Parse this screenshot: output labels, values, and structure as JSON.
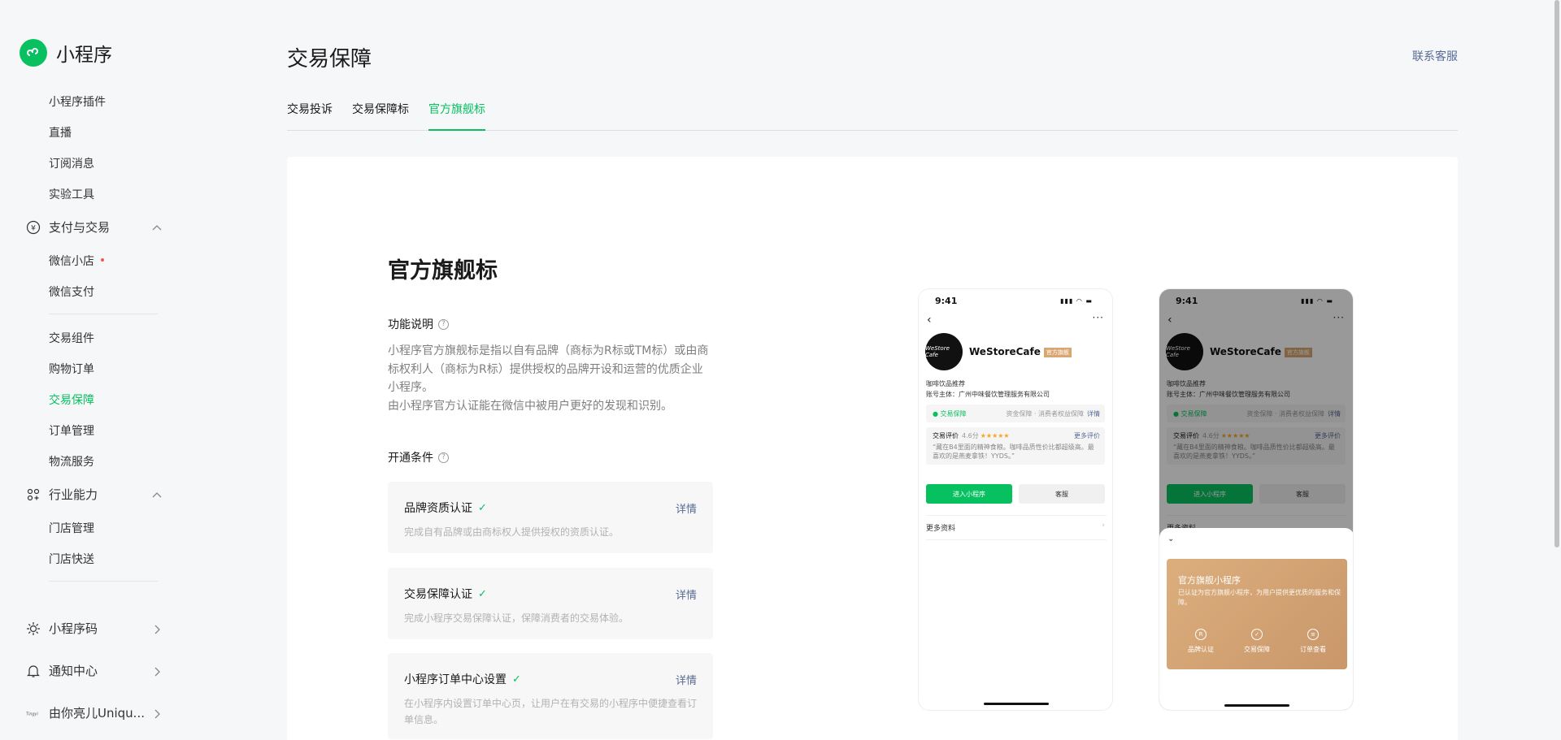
{
  "app": {
    "title": "小程序"
  },
  "sidebar": {
    "items_top": [
      {
        "label": "小程序插件"
      },
      {
        "label": "直播"
      },
      {
        "label": "订阅消息"
      },
      {
        "label": "实验工具"
      }
    ],
    "group_pay": {
      "label": "支付与交易",
      "icon": "yuan-icon"
    },
    "pay_items": [
      {
        "label": "微信小店",
        "badge_dot": true
      },
      {
        "label": "微信支付"
      }
    ],
    "trade_items": [
      {
        "label": "交易组件"
      },
      {
        "label": "购物订单"
      },
      {
        "label": "交易保障",
        "active": true
      },
      {
        "label": "订单管理"
      },
      {
        "label": "物流服务"
      }
    ],
    "group_industry": {
      "label": "行业能力",
      "icon": "industry-icon"
    },
    "industry_items": [
      {
        "label": "门店管理"
      },
      {
        "label": "门店快送"
      }
    ],
    "bottom": [
      {
        "label": "小程序码",
        "icon": "sun-icon"
      },
      {
        "label": "通知中心",
        "icon": "bell-icon"
      },
      {
        "label": "由你亮儿Uniqu...",
        "icon": "account-logo"
      }
    ]
  },
  "header": {
    "title": "交易保障",
    "contact": "联系客服"
  },
  "tabs": [
    {
      "label": "交易投诉"
    },
    {
      "label": "交易保障标"
    },
    {
      "label": "官方旗舰标",
      "active": true
    }
  ],
  "content": {
    "title": "官方旗舰标",
    "feature_heading": "功能说明",
    "feature_desc_1": "小程序官方旗舰标是指以自有品牌（商标为R标或TM标）或由商标权利人（商标为R标）提供授权的品牌开设和运营的优质企业小程序。",
    "feature_desc_2": "由小程序官方认证能在微信中被用户更好的发现和识别。",
    "conditions_heading": "开通条件",
    "conditions": [
      {
        "title": "品牌资质认证",
        "desc": "完成自有品牌或由商标权人提供授权的资质认证。",
        "link": "详情"
      },
      {
        "title": "交易保障认证",
        "desc": "完成小程序交易保障认证，保障消费者的交易体验。",
        "link": "详情"
      },
      {
        "title": "小程序订单中心设置",
        "desc": "在小程序内设置订单中心页，让用户在有交易的小程序中便捷查看订单信息。",
        "link": "详情"
      }
    ]
  },
  "phone": {
    "time": "9:41",
    "avatar_text": "WeStore Cafe",
    "brand": "WeStoreCafe",
    "tag": "官方旗舰",
    "line1": "咖啡饮品推荐",
    "line2": "账号主体：广州中味餐饮管理服务有限公司",
    "guarantee": "交易保障",
    "guarantee_desc": "资金保障 · 消费者权益保障",
    "guarantee_link": "详情",
    "review_label": "交易评价",
    "review_score": "4.6分",
    "review_stars": "★★★★★",
    "review_more": "更多评价",
    "review_text": "“藏在B4里面的精神食粮。咖啡品质性价比都超级高。最喜欢的是燕麦拿铁！YYDS。”",
    "enter_btn": "进入小程序",
    "service_btn": "客服",
    "more_info": "更多资料",
    "sheet_title": "官方旗舰小程序",
    "sheet_desc": "已认证为官方旗舰小程序，为用户提供更优质的服务和保障。",
    "features": [
      {
        "label": "品牌认证",
        "icon": "R"
      },
      {
        "label": "交易保障",
        "icon": "✓"
      },
      {
        "label": "订单查看",
        "icon": "≡"
      }
    ]
  }
}
